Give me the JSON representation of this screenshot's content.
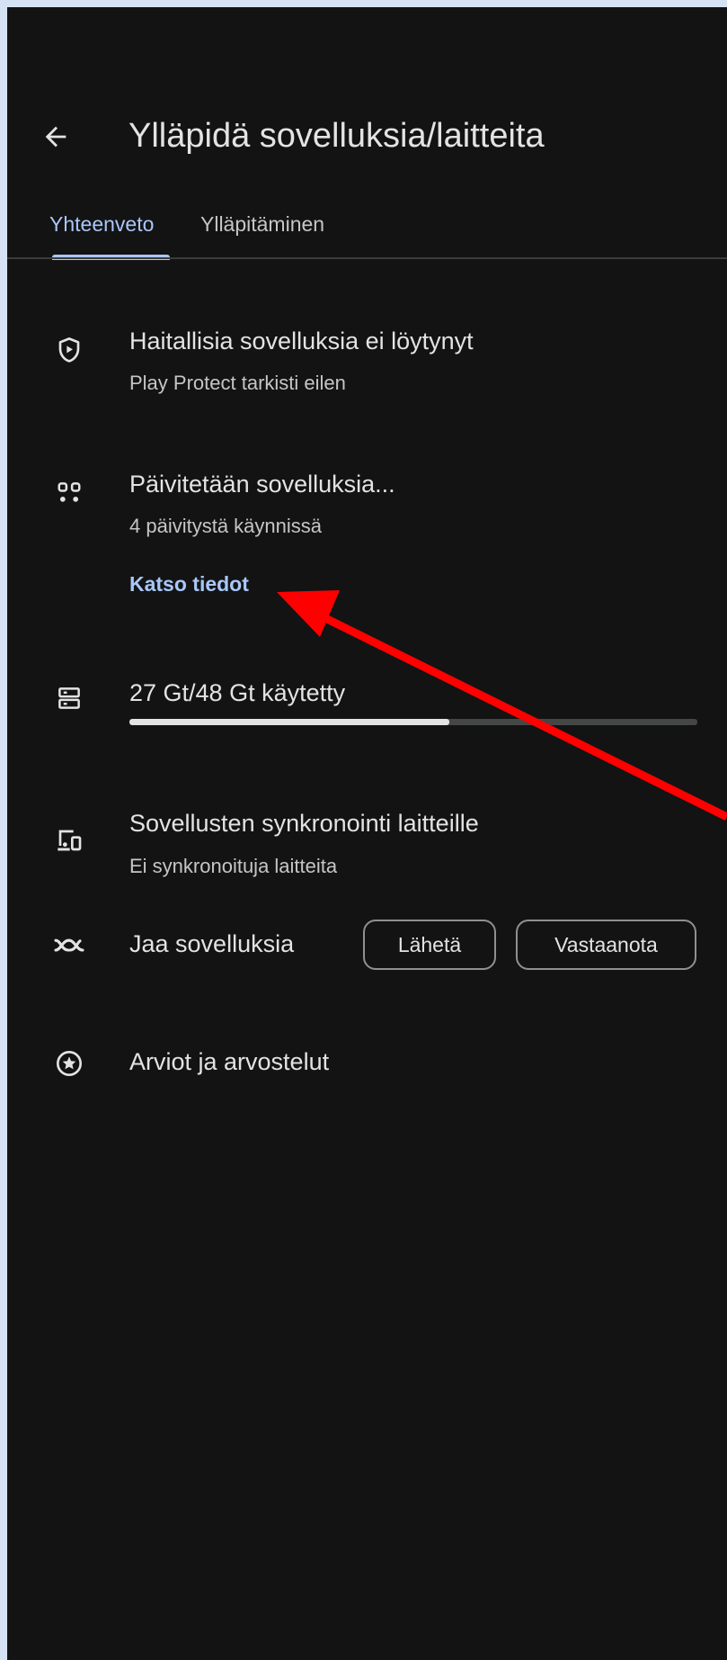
{
  "header": {
    "title": "Ylläpidä sovelluksia/laitteita",
    "back_icon": "arrow-left-icon"
  },
  "tabs": [
    {
      "label": "Yhteenveto",
      "selected": true
    },
    {
      "label": "Ylläpitäminen",
      "selected": false
    }
  ],
  "items": {
    "protect": {
      "icon": "shield-play-icon",
      "title": "Haitallisia sovelluksia ei löytynyt",
      "subtitle": "Play Protect tarkisti eilen"
    },
    "updates": {
      "icon": "apps-grid-icon",
      "title": "Päivitetään sovelluksia...",
      "subtitle": "4 päivitystä käynnissä",
      "link": "Katso tiedot"
    },
    "storage": {
      "icon": "storage-icon",
      "title": "27 Gt/48 Gt käytetty",
      "used_fraction": 0.5625
    },
    "sync": {
      "icon": "devices-icon",
      "title": "Sovellusten synkronointi laitteille",
      "subtitle": "Ei synkronoituja laitteita"
    },
    "share": {
      "icon": "nearby-share-icon",
      "title": "Jaa sovelluksia",
      "send_label": "Lähetä",
      "receive_label": "Vastaanota"
    },
    "ratings": {
      "icon": "star-circle-icon",
      "title": "Arviot ja arvostelut"
    }
  },
  "colors": {
    "background": "#131313",
    "accent": "#a8c7fa",
    "annotation_arrow": "#ff0000"
  }
}
